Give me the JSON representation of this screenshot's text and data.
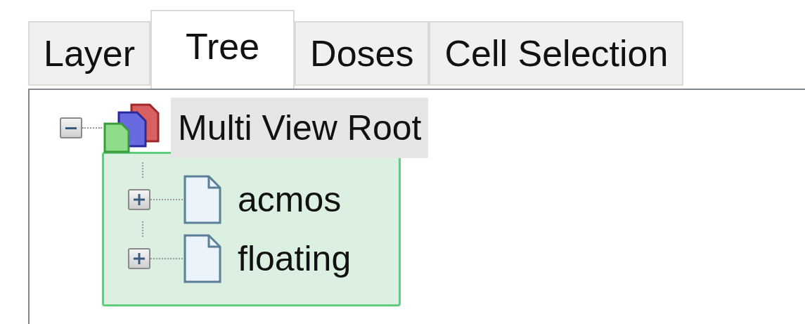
{
  "tabs": [
    {
      "label": "Layer",
      "selected": false
    },
    {
      "label": "Tree",
      "selected": true
    },
    {
      "label": "Doses",
      "selected": false
    },
    {
      "label": "Cell Selection",
      "selected": false
    }
  ],
  "tree": [
    {
      "label": "Multi View Root",
      "expanded": true,
      "selected": true,
      "children": [
        {
          "label": "acmos",
          "expanded": false,
          "selected": false
        },
        {
          "label": "floating",
          "expanded": false,
          "selected": false
        }
      ]
    }
  ]
}
